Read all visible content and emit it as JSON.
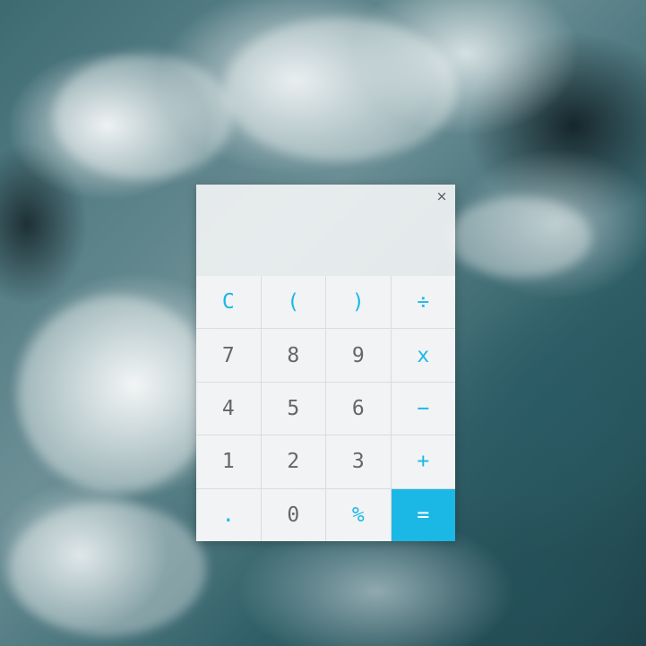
{
  "window": {
    "close_glyph": "×"
  },
  "display": {
    "value": ""
  },
  "colors": {
    "accent": "#1bb8e6",
    "key_text": "#666666",
    "key_background": "#f2f3f4"
  },
  "keys": [
    {
      "label": "C",
      "name": "clear-key",
      "style": "accent"
    },
    {
      "label": "(",
      "name": "open-paren-key",
      "style": "accent"
    },
    {
      "label": ")",
      "name": "close-paren-key",
      "style": "accent"
    },
    {
      "label": "÷",
      "name": "divide-key",
      "style": "accent"
    },
    {
      "label": "7",
      "name": "digit-7-key",
      "style": "digit"
    },
    {
      "label": "8",
      "name": "digit-8-key",
      "style": "digit"
    },
    {
      "label": "9",
      "name": "digit-9-key",
      "style": "digit"
    },
    {
      "label": "x",
      "name": "multiply-key",
      "style": "accent"
    },
    {
      "label": "4",
      "name": "digit-4-key",
      "style": "digit"
    },
    {
      "label": "5",
      "name": "digit-5-key",
      "style": "digit"
    },
    {
      "label": "6",
      "name": "digit-6-key",
      "style": "digit"
    },
    {
      "label": "−",
      "name": "subtract-key",
      "style": "accent"
    },
    {
      "label": "1",
      "name": "digit-1-key",
      "style": "digit"
    },
    {
      "label": "2",
      "name": "digit-2-key",
      "style": "digit"
    },
    {
      "label": "3",
      "name": "digit-3-key",
      "style": "digit"
    },
    {
      "label": "+",
      "name": "add-key",
      "style": "accent"
    },
    {
      "label": ".",
      "name": "decimal-key",
      "style": "accent"
    },
    {
      "label": "0",
      "name": "digit-0-key",
      "style": "digit"
    },
    {
      "label": "%",
      "name": "percent-key",
      "style": "accent"
    },
    {
      "label": "=",
      "name": "equals-key",
      "style": "equals"
    }
  ]
}
